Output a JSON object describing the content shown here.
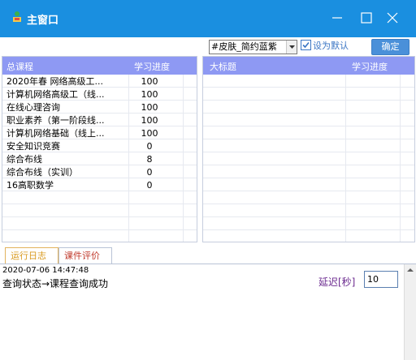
{
  "window": {
    "title": "主窗口",
    "accent_color": "#1a8fe0",
    "icons": [
      "app-icon",
      "minimize-icon",
      "maximize-icon",
      "close-icon"
    ]
  },
  "toolbar": {
    "skin_value": "#皮肤_简约蓝紫",
    "set_default_label": "设为默认",
    "set_default_checked": true,
    "confirm_label": "确定"
  },
  "course_table": {
    "header_color": "#8e99f3",
    "columns": [
      "总课程",
      "学习进度"
    ],
    "rows": [
      {
        "name": "2020年春 网络高级工...",
        "progress": "100"
      },
      {
        "name": "计算机网络高级工（线...",
        "progress": "100"
      },
      {
        "name": "在线心理咨询",
        "progress": "100"
      },
      {
        "name": "职业素养（第一阶段线...",
        "progress": "100"
      },
      {
        "name": "计算机网络基础（线上...",
        "progress": "100"
      },
      {
        "name": "安全知识竞赛",
        "progress": "0"
      },
      {
        "name": "综合布线",
        "progress": "8"
      },
      {
        "name": "综合布线（实训）",
        "progress": "0"
      },
      {
        "name": "16高职数学",
        "progress": "0"
      }
    ]
  },
  "detail_table": {
    "columns": [
      "大标题",
      "学习进度"
    ]
  },
  "tabs": [
    {
      "label": "运行日志"
    },
    {
      "label": "课件评价"
    }
  ],
  "log": {
    "timestamp": "2020-07-06 14:47:48",
    "message": "查询状态→课程查询成功",
    "delay_label": "延迟[秒]",
    "delay_value": "10"
  }
}
